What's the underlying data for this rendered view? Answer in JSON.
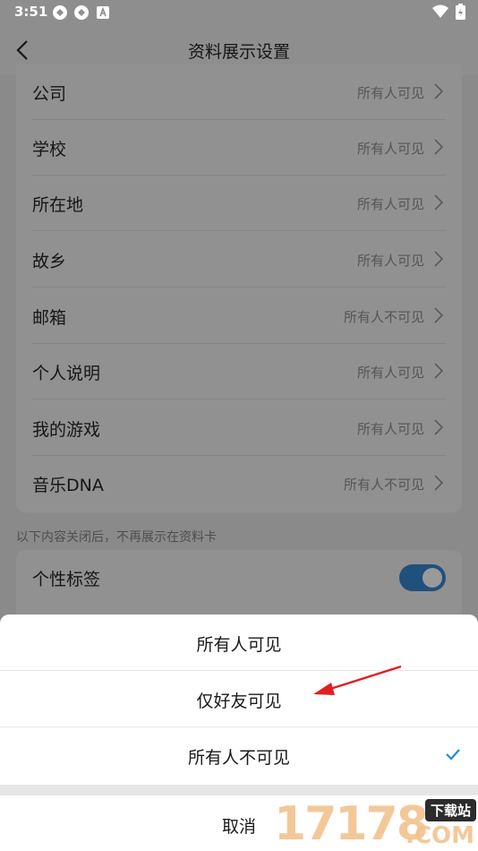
{
  "status_bar": {
    "time": "3:51",
    "left_icons": [
      "sync-icon",
      "sync-icon",
      "a-badge-icon"
    ],
    "right_icons": [
      "wifi-icon",
      "battery-icon"
    ]
  },
  "nav": {
    "title": "资料展示设置",
    "back_icon": "chevron-left-icon"
  },
  "settings": [
    {
      "label": "公司",
      "value": "所有人可见"
    },
    {
      "label": "学校",
      "value": "所有人可见"
    },
    {
      "label": "所在地",
      "value": "所有人可见"
    },
    {
      "label": "故乡",
      "value": "所有人可见"
    },
    {
      "label": "邮箱",
      "value": "所有人不可见"
    },
    {
      "label": "个人说明",
      "value": "所有人可见"
    },
    {
      "label": "我的游戏",
      "value": "所有人可见"
    },
    {
      "label": "音乐DNA",
      "value": "所有人不可见"
    }
  ],
  "section_note": "以下内容关闭后，不再展示在资料卡",
  "tags": {
    "label": "个性标签",
    "toggle_on": true
  },
  "sheet": {
    "options": [
      "所有人可见",
      "仅好友可见",
      "所有人不可见"
    ],
    "selected_index": 2,
    "cancel": "取消"
  },
  "watermark": {
    "number": "17178",
    "badge": "下载站",
    "suffix": ".COM"
  },
  "colors": {
    "accent": "#1e88e5",
    "annotation_arrow": "#e02020",
    "toggle": "#20507c"
  }
}
